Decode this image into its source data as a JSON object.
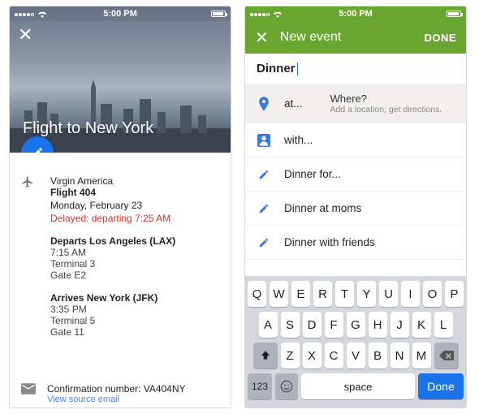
{
  "status": {
    "time": "5:00 PM"
  },
  "left": {
    "hero_title": "Flight to New York",
    "airline": "Virgin America",
    "flight": "Flight 404",
    "date": "Monday, February 23",
    "delay": "Delayed: departing 7:25 AM",
    "departs_title": "Departs Los Angeles (LAX)",
    "departs_time": "7:15 AM",
    "departs_terminal": "Terminal 3",
    "departs_gate": "Gate E2",
    "arrives_title": "Arrives New York (JFK)",
    "arrives_time": "3:35 PM",
    "arrives_terminal": "Terminal 5",
    "arrives_gate": "Gate 11",
    "confirmation": "Confirmation number: VA404NY",
    "source_link": "View source email"
  },
  "right": {
    "appbar_title": "New event",
    "done": "DONE",
    "event_title": "Dinner",
    "at_label": "at...",
    "where_q": "Where?",
    "where_sub": "Add a location, get directions.",
    "with_label": "with...",
    "sugg1": "Dinner for...",
    "sugg2": "Dinner at moms",
    "sugg3": "Dinner with friends"
  },
  "keyboard": {
    "row1": [
      "Q",
      "W",
      "E",
      "R",
      "T",
      "Y",
      "U",
      "I",
      "O",
      "P"
    ],
    "row2": [
      "A",
      "S",
      "D",
      "F",
      "G",
      "H",
      "J",
      "K",
      "L"
    ],
    "row3": [
      "Z",
      "X",
      "C",
      "V",
      "B",
      "N",
      "M"
    ],
    "sym": "123",
    "space": "space",
    "done": "Done"
  }
}
